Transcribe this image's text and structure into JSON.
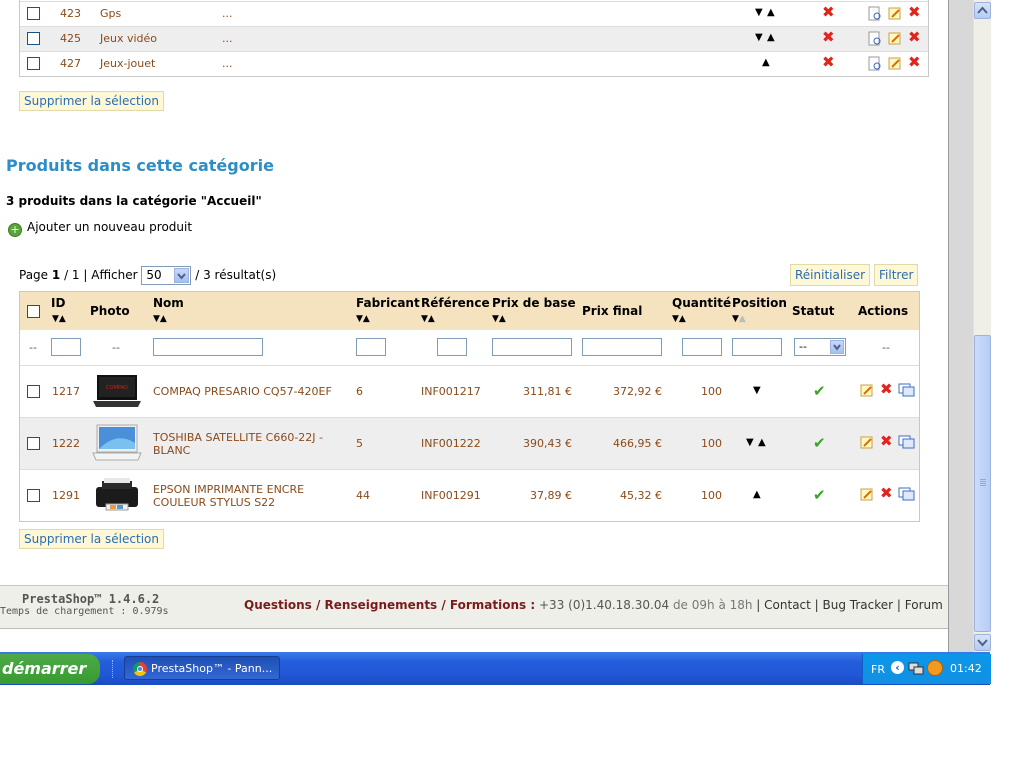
{
  "category_rows": [
    {
      "id": "423",
      "name": "Gps",
      "desc": "..."
    },
    {
      "id": "425",
      "name": "Jeux vidéo",
      "desc": "..."
    },
    {
      "id": "427",
      "name": "Jeux-jouet",
      "desc": "..."
    }
  ],
  "delete_selection_label": "Supprimer la sélection",
  "section_title": "Produits dans cette catégorie",
  "count_text": "3 produits dans la catégorie \"Accueil\"",
  "add_product_label": "Ajouter un nouveau produit",
  "pager": {
    "page_prefix": "Page",
    "page_current": "1",
    "page_sep": "/ 1 | Afficher",
    "per_page": "50",
    "results": "/ 3 résultat(s)"
  },
  "reset_label": "Réinitialiser",
  "filter_label": "Filtrer",
  "columns": {
    "id": "ID",
    "photo": "Photo",
    "name": "Nom",
    "manufacturer": "Fabricant",
    "reference": "Référence",
    "base_price": "Prix de base",
    "final_price": "Prix final",
    "quantity": "Quantité",
    "position": "Position",
    "status": "Statut",
    "actions": "Actions"
  },
  "filter_placeholder": "--",
  "status_select": "--",
  "products": [
    {
      "id": "1217",
      "name": "COMPAQ PRESARIO CQ57-420EF",
      "manufacturer": "6",
      "reference": "INF001217",
      "base_price": "311,81 €",
      "final_price": "372,92 €",
      "quantity": "100"
    },
    {
      "id": "1222",
      "name": "TOSHIBA SATELLITE C660-22J - BLANC",
      "manufacturer": "5",
      "reference": "INF001222",
      "base_price": "390,43 €",
      "final_price": "466,95 €",
      "quantity": "100"
    },
    {
      "id": "1291",
      "name": "EPSON IMPRIMANTE ENCRE COULEUR STYLUS S22",
      "manufacturer": "44",
      "reference": "INF001291",
      "base_price": "37,89 €",
      "final_price": "45,32 €",
      "quantity": "100"
    }
  ],
  "footer": {
    "version": "PrestaShop™ 1.4.6.2",
    "load_time": "Temps de chargement : 0.979s",
    "questions": "Questions / Renseignements / Formations :",
    "phone": "+33 (0)1.40.18.30.04",
    "hours": "de 09h à 18h",
    "contact": "Contact",
    "bugtracker": "Bug Tracker",
    "forum": "Forum"
  },
  "taskbar": {
    "start": "démarrer",
    "task": "PrestaShop™ - Pann...",
    "lang": "FR",
    "clock": "01:42"
  },
  "colors": {
    "accent": "#2c8ec8",
    "header_bg": "#f5e3bf",
    "cell_text": "#8a4a1a",
    "taskbar": "#245edb"
  }
}
